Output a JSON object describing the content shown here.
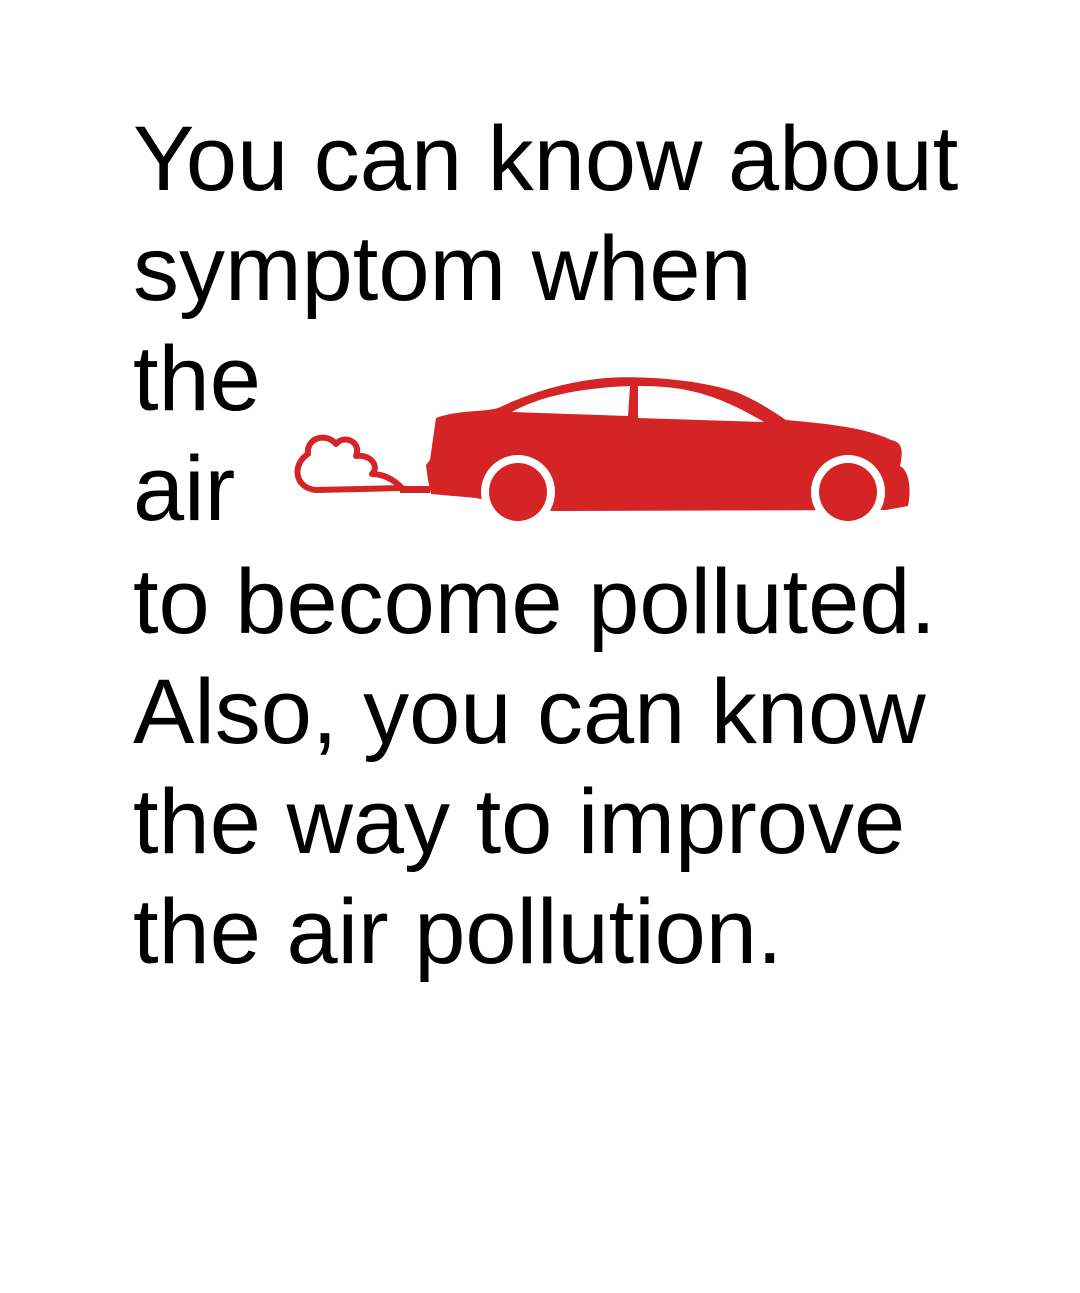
{
  "message": {
    "lines": [
      "You can know about",
      "symptom when",
      "the",
      "air",
      "to become polluted.",
      "Also, you can know",
      "the way to improve",
      "the air pollution."
    ]
  },
  "illustration": {
    "icon": "car-exhaust-icon",
    "color": "#d42426"
  }
}
